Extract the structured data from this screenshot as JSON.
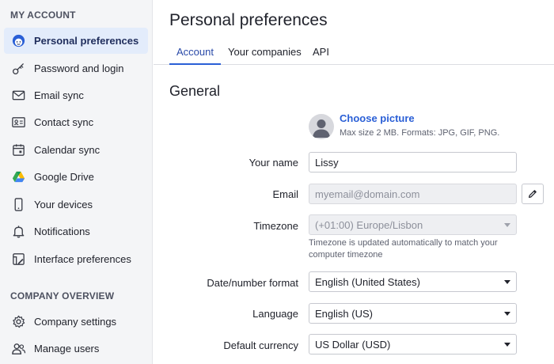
{
  "sidebar": {
    "my_account_heading": "MY ACCOUNT",
    "company_overview_heading": "COMPANY OVERVIEW",
    "my_account_items": [
      {
        "label": "Personal preferences",
        "icon": "face-icon",
        "active": true
      },
      {
        "label": "Password and login",
        "icon": "key-icon"
      },
      {
        "label": "Email sync",
        "icon": "envelope-icon"
      },
      {
        "label": "Contact sync",
        "icon": "contact-card-icon"
      },
      {
        "label": "Calendar sync",
        "icon": "calendar-icon"
      },
      {
        "label": "Google Drive",
        "icon": "google-drive-icon"
      },
      {
        "label": "Your devices",
        "icon": "phone-icon"
      },
      {
        "label": "Notifications",
        "icon": "bell-icon"
      },
      {
        "label": "Interface preferences",
        "icon": "interface-edit-icon"
      }
    ],
    "company_items": [
      {
        "label": "Company settings",
        "icon": "gear-icon"
      },
      {
        "label": "Manage users",
        "icon": "users-icon"
      }
    ]
  },
  "main": {
    "title": "Personal preferences",
    "tabs": [
      {
        "label": "Account",
        "active": true
      },
      {
        "label": "Your companies"
      },
      {
        "label": "API"
      }
    ],
    "section_title": "General",
    "picture": {
      "choose_label": "Choose picture",
      "max_size": "Max size 2 MB. Formats: JPG, GIF, PNG."
    },
    "form": {
      "name_label": "Your name",
      "name_value": "Lissy",
      "email_label": "Email",
      "email_placeholder": "myemail@domain.com",
      "timezone_label": "Timezone",
      "timezone_value": "(+01:00) Europe/Lisbon",
      "timezone_hint": "Timezone is updated automatically to match your computer timezone",
      "format_label": "Date/number format",
      "format_value": "English (United States)",
      "language_label": "Language",
      "language_value": "English (US)",
      "currency_label": "Default currency",
      "currency_value": "US Dollar (USD)"
    }
  },
  "colors": {
    "accent": "#2a5fd6",
    "active_nav_bg": "#e3ecfb",
    "sidebar_bg": "#f4f5f7"
  }
}
